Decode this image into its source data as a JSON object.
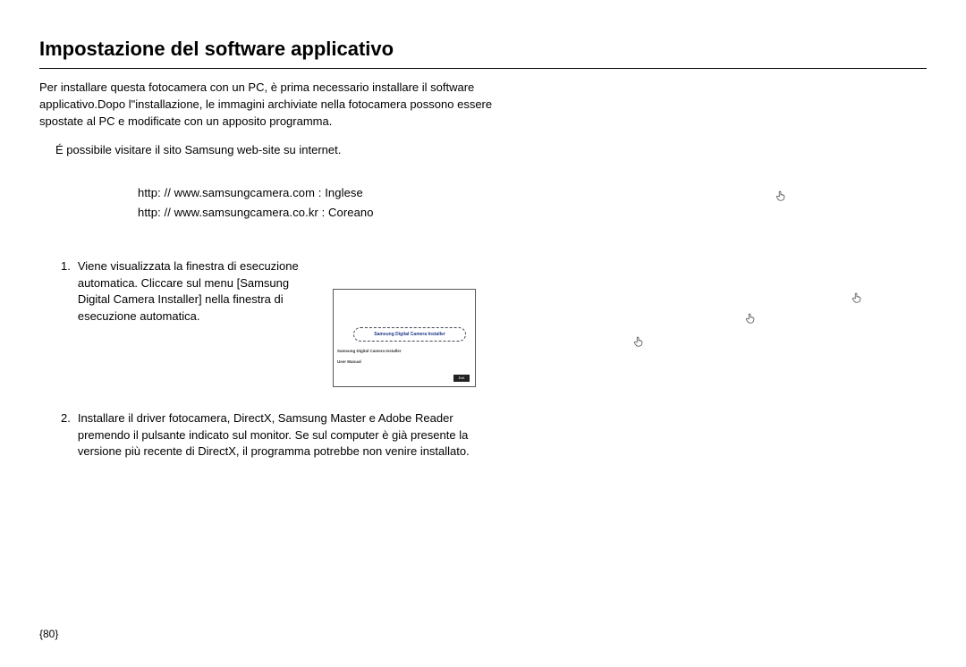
{
  "title": "Impostazione del software applicativo",
  "intro": "Per installare questa fotocamera con un PC, è prima necessario installare il software applicativo.Dopo l\"installazione, le immagini archiviate nella fotocamera possono essere spostate al PC e modificate con un apposito programma.",
  "website_note": "É possibile visitare il sito Samsung  web-site su internet.",
  "urls": {
    "en": "http:  //  www.samsungcamera.com  :  Inglese",
    "kr": "http:  //  www.samsungcamera.co.kr  :  Coreano"
  },
  "steps": {
    "s1_num": "1.",
    "s1_text": "Viene visualizzata la finestra di esecuzione automatica.  Cliccare sul menu [Samsung Digital Camera Installer] nella finestra di esecuzione automatica.",
    "s2_num": "2.",
    "s2_text": "Installare il driver fotocamera, DirectX, Samsung Master e Adobe Reader premendo il pulsante indicato sul monitor.  Se sul computer è già presente la versione più recente di DirectX, il programma potrebbe non venire installato."
  },
  "installer": {
    "main_btn": "Samsung Digital Camera Installer",
    "line2": "Samsung Digital Camera Installer",
    "manual": "User Manual",
    "exit": "Exit"
  },
  "page": "{80}"
}
